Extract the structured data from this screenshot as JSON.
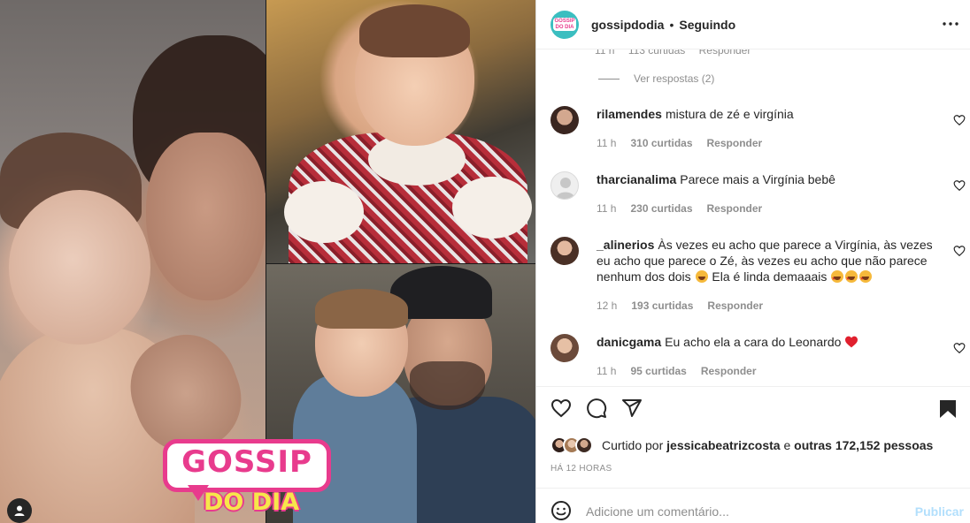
{
  "header": {
    "username": "gossipdodia",
    "separator": "•",
    "follow_status": "Seguindo",
    "brand_color": "#3bbec0"
  },
  "overlay": {
    "logo_line1": "GOSSIP",
    "logo_line2": "DO DIA"
  },
  "partial_comment": {
    "time": "11 h",
    "likes": "113 curtidas",
    "reply": "Responder"
  },
  "view_replies": "Ver respostas (2)",
  "comments": [
    {
      "user": "rilamendes",
      "text": "mistura de zé e virgínia",
      "time": "11 h",
      "likes": "310 curtidas",
      "reply": "Responder"
    },
    {
      "user": "tharcianalima",
      "text": "Parece mais a Virgínia bebê",
      "time": "11 h",
      "likes": "230 curtidas",
      "reply": "Responder"
    },
    {
      "user": "_alinerios",
      "text": "Às vezes eu acho que parece a Virgínia, às vezes eu acho que parece o Zé, às vezes eu acho que não parece nenhum dos dois",
      "text2": "Ela é linda demaaais",
      "time": "12 h",
      "likes": "193 curtidas",
      "reply": "Responder"
    },
    {
      "user": "danicgama",
      "text": "Eu acho ela a cara do Leonardo",
      "time": "11 h",
      "likes": "95 curtidas",
      "reply": "Responder"
    }
  ],
  "likes": {
    "prefix": "Curtido por",
    "user": "jessicabeatrizcosta",
    "connector": "e",
    "others": "outras 172,152 pessoas"
  },
  "timestamp": "HÁ 12 HORAS",
  "add_comment": {
    "placeholder": "Adicione um comentário...",
    "post_label": "Publicar"
  },
  "icons": [
    "heart-icon",
    "comment-icon",
    "share-icon",
    "bookmark-icon",
    "more-options-icon",
    "emoji-icon",
    "user-tag-icon"
  ]
}
